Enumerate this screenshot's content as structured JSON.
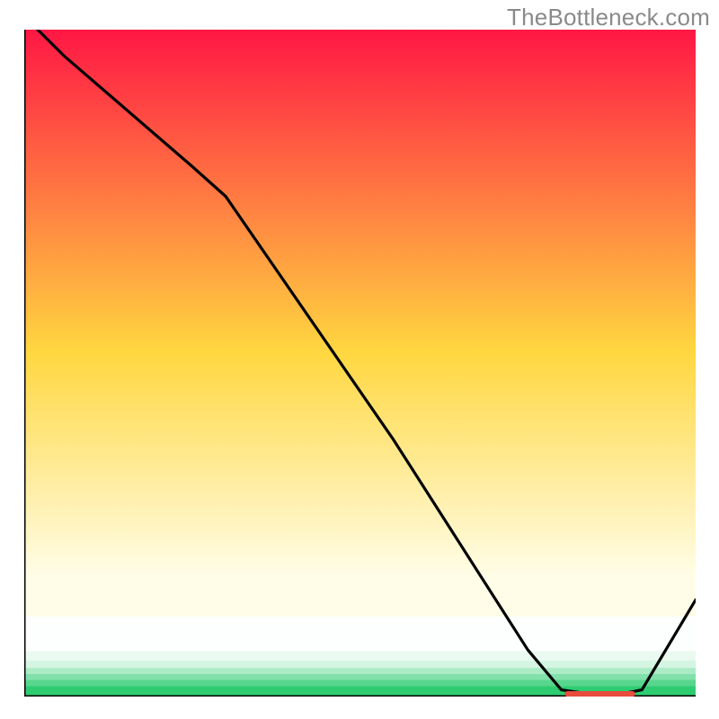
{
  "watermark": "TheBottleneck.com",
  "chart_data": {
    "type": "line",
    "title": "",
    "xlabel": "",
    "ylabel": "",
    "xlim": [
      0,
      100
    ],
    "ylim": [
      0,
      100
    ],
    "series": [
      {
        "name": "curve",
        "x": [
          0,
          6,
          25,
          30,
          55,
          75,
          80,
          87,
          92,
          100
        ],
        "values": [
          102,
          96,
          79.5,
          75,
          38.5,
          7,
          1,
          0,
          1,
          14.5
        ]
      }
    ],
    "marker": {
      "x_start": 80.5,
      "x_end": 91,
      "y": 0.4
    },
    "bands": [
      {
        "y0": 0.0,
        "y1": 1.6,
        "color": "#2ecc71"
      },
      {
        "y0": 1.6,
        "y1": 2.5,
        "color": "#58d68d"
      },
      {
        "y0": 2.5,
        "y1": 3.4,
        "color": "#82e0aa"
      },
      {
        "y0": 3.4,
        "y1": 4.3,
        "color": "#abebc6"
      },
      {
        "y0": 4.3,
        "y1": 5.4,
        "color": "#d5f5e3"
      },
      {
        "y0": 5.4,
        "y1": 6.8,
        "color": "#eafaf1"
      },
      {
        "y0": 6.8,
        "y1": 12.0,
        "color": "#fdfefe"
      }
    ],
    "gradient": {
      "top": "#ff1744",
      "middle": "#ffd740",
      "bottom": "#fffde7"
    }
  }
}
